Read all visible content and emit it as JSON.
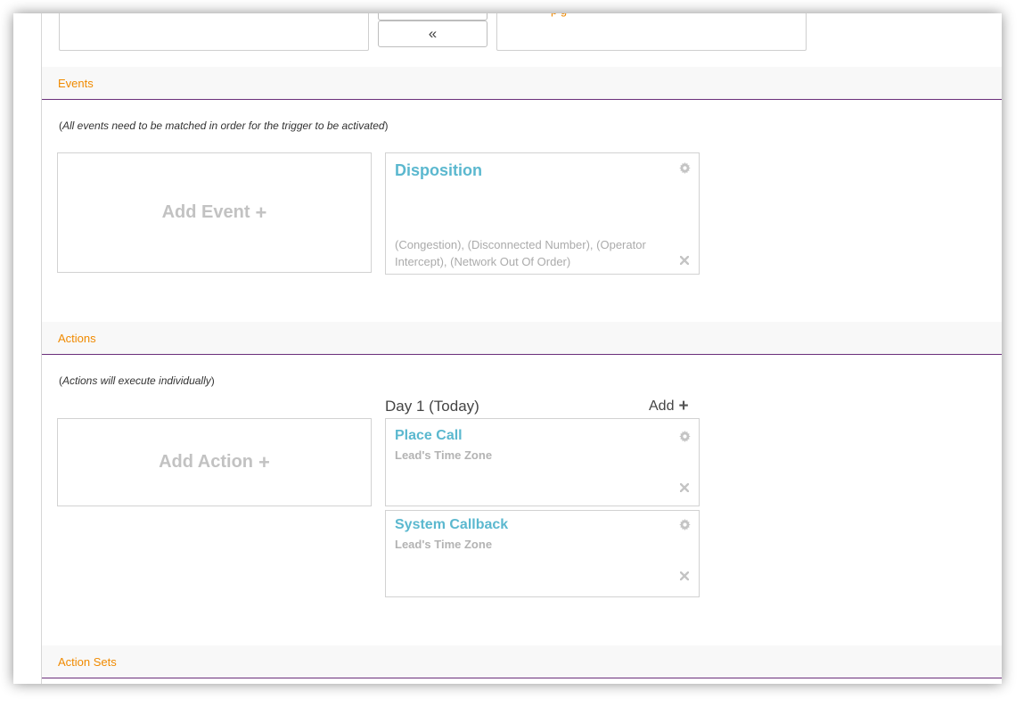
{
  "top": {
    "move_left_symbol": "«",
    "right_box_text": "p g"
  },
  "events": {
    "header": "Events",
    "note_open": "(",
    "note_text": "All events need to be matched in order for the trigger to be activated",
    "note_close": ")",
    "add_label": "Add Event",
    "add_plus": "+",
    "cards": [
      {
        "title": "Disposition",
        "description": "(Congestion), (Disconnected Number), (Operator Intercept), (Network Out Of Order)"
      }
    ]
  },
  "actions": {
    "header": "Actions",
    "note_open": "(",
    "note_text": "Actions will execute individually",
    "note_close": ")",
    "add_label": "Add Action",
    "add_plus": "+",
    "day_label": "Day 1 (Today)",
    "day_add_label": "Add",
    "day_add_plus": "+",
    "cards": [
      {
        "title": "Place Call",
        "subtitle": "Lead's Time Zone"
      },
      {
        "title": "System Callback",
        "subtitle": "Lead's Time Zone"
      }
    ]
  },
  "action_sets": {
    "header": "Action Sets"
  },
  "icons": {
    "settings": "gear-icon",
    "remove": "close-icon"
  },
  "colors": {
    "section_header_text": "#f08a00",
    "section_rule": "#6b2f7b",
    "card_title": "#5bb8cf",
    "muted_text": "#b3b3b3"
  }
}
